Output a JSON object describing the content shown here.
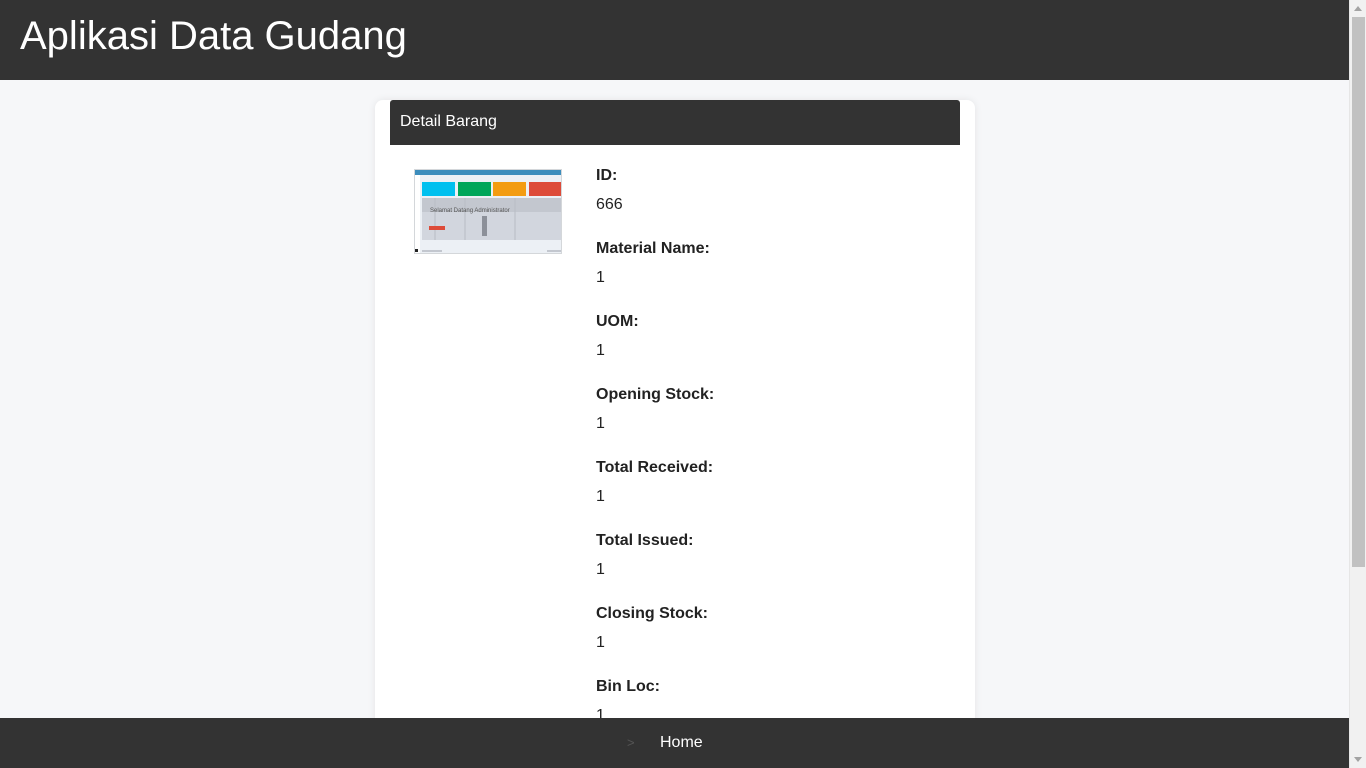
{
  "app": {
    "title": "Aplikasi Data Gudang"
  },
  "card": {
    "header": "Detail Barang",
    "thumbnail": {
      "caption": "Selamat Datang Administrator"
    },
    "fields": [
      {
        "label": "ID:",
        "value": "666"
      },
      {
        "label": "Material Name:",
        "value": "1"
      },
      {
        "label": "UOM:",
        "value": "1"
      },
      {
        "label": "Opening Stock:",
        "value": "1"
      },
      {
        "label": "Total Received:",
        "value": "1"
      },
      {
        "label": "Total Issued:",
        "value": "1"
      },
      {
        "label": "Closing Stock:",
        "value": "1"
      },
      {
        "label": "Bin Loc:",
        "value": "1"
      }
    ]
  },
  "footer": {
    "separator": ">",
    "home_label": "Home"
  },
  "colors": {
    "bar": "#333333",
    "background": "#f6f7f9",
    "card": "#ffffff"
  }
}
